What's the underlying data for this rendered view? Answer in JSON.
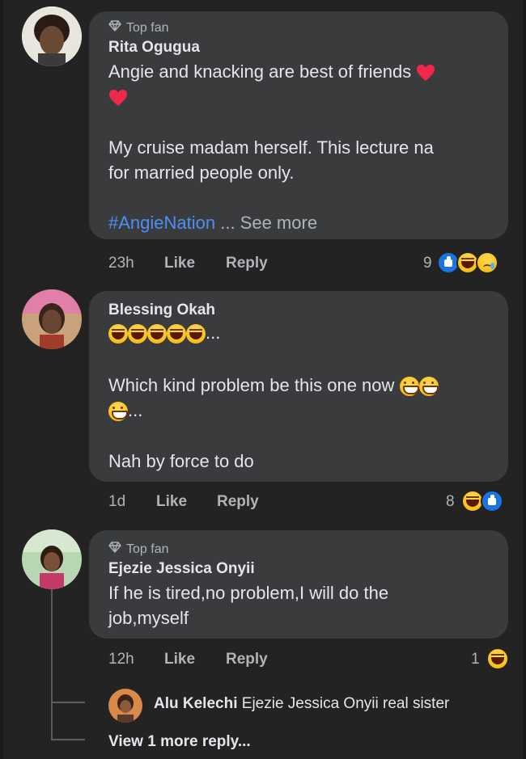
{
  "comments": [
    {
      "badge": "Top fan",
      "name": "Rita Ogugua",
      "line1": "Angie and knacking are best of friends",
      "line2": "My cruise madam herself. This lecture na",
      "line3": "for married people only.",
      "hashtag": "#AngieNation",
      "see_more": " ... See more",
      "time": "23h",
      "like": "Like",
      "reply": "Reply",
      "reaction_count": "9"
    },
    {
      "name": "Blessing Okah",
      "emoji_trail": "...",
      "line1": "Which kind problem be this one now",
      "line1_trail": "...",
      "line2": "Nah by force to do",
      "time": "1d",
      "like": "Like",
      "reply": "Reply",
      "reaction_count": "8"
    },
    {
      "badge": "Top fan",
      "name": "Ejezie Jessica Onyii",
      "line1": "If he is tired,no problem,I will do the",
      "line2": "job,myself",
      "time": "12h",
      "like": "Like",
      "reply": "Reply",
      "reaction_count": "1"
    }
  ],
  "reply": {
    "name": "Alu Kelechi",
    "text": "Ejezie Jessica Onyii real sister"
  },
  "view_more": "View 1 more reply...",
  "colors": {
    "background": "#232324",
    "bubble": "#3a3b3c",
    "link": "#4e8ef7",
    "muted": "#b0b3b8"
  }
}
